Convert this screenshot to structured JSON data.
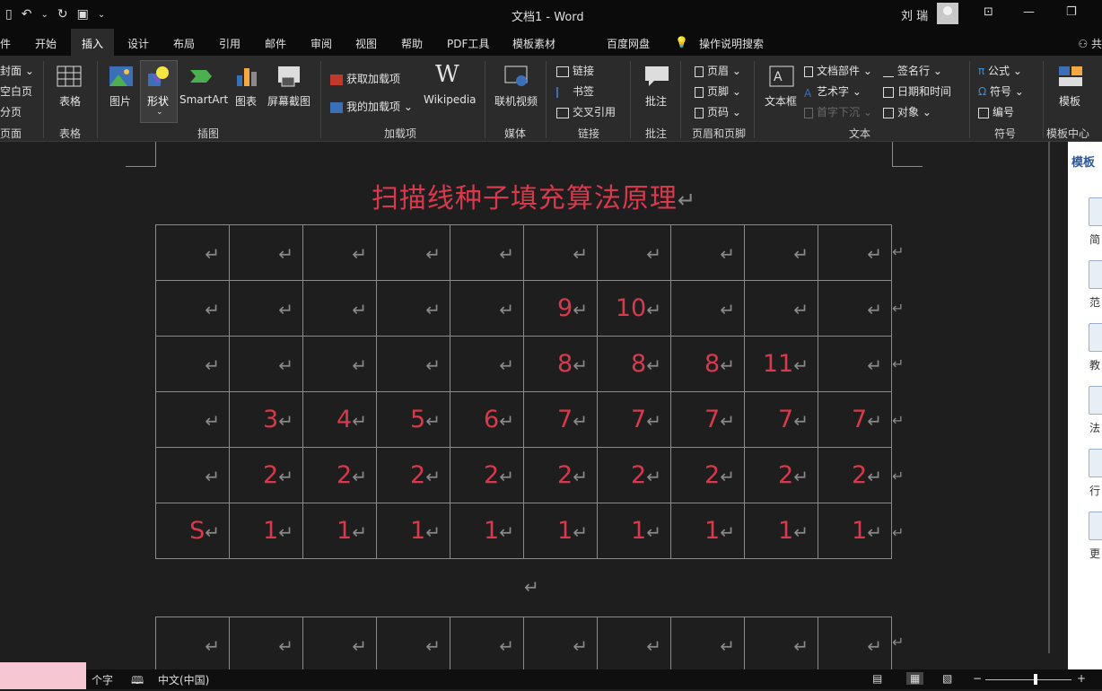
{
  "window": {
    "title": "文档1  -  Word",
    "user": "刘 瑞",
    "controls": [
      "⊡",
      "—",
      "❐"
    ]
  },
  "qat": {
    "undo": "↶",
    "undo_caret": "⌄",
    "redo": "↻",
    "save": "▣",
    "more": "⌄"
  },
  "tabs": [
    "件",
    "开始",
    "插入",
    "设计",
    "布局",
    "引用",
    "邮件",
    "审阅",
    "视图",
    "帮助",
    "PDF工具",
    "模板素材",
    "百度网盘",
    "操作说明搜索"
  ],
  "tab_share": "共",
  "ribbon": {
    "pages": [
      "封面 ⌄",
      "空白页",
      "分页"
    ],
    "table": "表格",
    "pictures": "图片",
    "shapes": "形状",
    "smartart": "SmartArt",
    "chart": "图表",
    "screenshot": "屏幕截图",
    "get_addins": "获取加载项",
    "my_addins": "我的加载项",
    "wikipedia": "Wikipedia",
    "online_video": "联机视频",
    "link": "链接",
    "bookmark": "书签",
    "crossref": "交叉引用",
    "comment": "批注",
    "header": "页眉 ⌄",
    "footer": "页脚 ⌄",
    "pagenum": "页码 ⌄",
    "textbox": "文本框",
    "quickparts": "文档部件 ⌄",
    "wordart": "艺术字 ⌄",
    "dropcap": "首字下沉 ⌄",
    "signature": "签名行 ⌄",
    "datetime": "日期和时间",
    "object": "对象 ⌄",
    "equation": "公式 ⌄",
    "symbol": "符号 ⌄",
    "number": "编号",
    "template": "模板",
    "groups": [
      "页面",
      "表格",
      "插图",
      "加载项",
      "媒体",
      "链接",
      "批注",
      "页眉和页脚",
      "文本",
      "符号",
      "模板中心"
    ]
  },
  "document": {
    "title": "扫描线种子填充算法原理",
    "para_mark": "↵",
    "grid": [
      [
        "↵",
        "↵",
        "↵",
        "↵",
        "↵",
        "↵",
        "↵",
        "↵",
        "↵",
        "↵"
      ],
      [
        "↵",
        "↵",
        "↵",
        "↵",
        "↵",
        "9↵",
        "10↵",
        "↵",
        "↵",
        "↵"
      ],
      [
        "↵",
        "↵",
        "↵",
        "↵",
        "↵",
        "8↵",
        "8↵",
        "8↵",
        "11↵",
        "↵"
      ],
      [
        "↵",
        "3↵",
        "4↵",
        "5↵",
        "6↵",
        "7↵",
        "7↵",
        "7↵",
        "7↵",
        "7↵"
      ],
      [
        "↵",
        "2↵",
        "2↵",
        "2↵",
        "2↵",
        "2↵",
        "2↵",
        "2↵",
        "2↵",
        "2↵"
      ],
      [
        "S↵",
        "1↵",
        "1↵",
        "1↵",
        "1↵",
        "1↵",
        "1↵",
        "1↵",
        "1↵",
        "1↵"
      ]
    ],
    "grid2_row": [
      "↵",
      "↵",
      "↵",
      "↵",
      "↵",
      "↵",
      "↵",
      "↵",
      "↵",
      "↵"
    ]
  },
  "pane": {
    "title": "模板",
    "items": [
      "简",
      "范",
      "教",
      "法",
      "行",
      "更"
    ]
  },
  "status": {
    "words": "个字",
    "lang": "中文(中国)",
    "zoom_minus": "−",
    "zoom_plus": "+"
  },
  "colors": {
    "accent": "#d8394c",
    "dark_bg": "#1e1e1e",
    "ribbon_bg": "#2b2b2b"
  }
}
